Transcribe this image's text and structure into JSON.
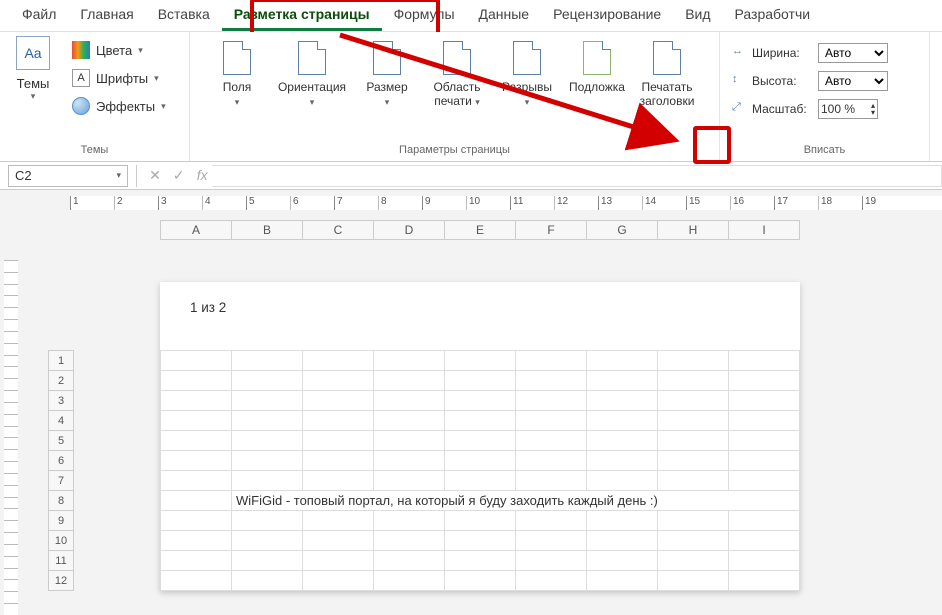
{
  "tabs": [
    "Файл",
    "Главная",
    "Вставка",
    "Разметка страницы",
    "Формулы",
    "Данные",
    "Рецензирование",
    "Вид",
    "Разработчи"
  ],
  "active_tab_index": 3,
  "themes_group": {
    "label": "Темы",
    "big": "Темы",
    "colors": "Цвета",
    "fonts": "Шрифты",
    "effects": "Эффекты"
  },
  "page_params_group": {
    "label": "Параметры страницы",
    "margins": "Поля",
    "orientation": "Ориентация",
    "size": "Размер",
    "print_area": "Область печати",
    "breaks": "Разрывы",
    "background": "Подложка",
    "print_titles": "Печатать заголовки"
  },
  "scale_group": {
    "label": "Вписать",
    "width": "Ширина:",
    "height": "Высота:",
    "scale": "Масштаб:",
    "auto": "Авто",
    "scale_value": "100 %"
  },
  "formula_bar": {
    "cell_ref": "C2"
  },
  "ruler_top": [
    "1",
    "2",
    "3",
    "4",
    "5",
    "6",
    "7",
    "8",
    "9",
    "10",
    "11",
    "12",
    "13",
    "14",
    "15",
    "16",
    "17",
    "18",
    "19"
  ],
  "columns": [
    "A",
    "B",
    "C",
    "D",
    "E",
    "F",
    "G",
    "H",
    "I"
  ],
  "rows": [
    "1",
    "2",
    "3",
    "4",
    "5",
    "6",
    "7",
    "8",
    "9",
    "10",
    "11",
    "12"
  ],
  "page_info": "1 из 2",
  "cell_text": "WiFiGid - топовый портал, на который я буду заходить каждый день :)"
}
